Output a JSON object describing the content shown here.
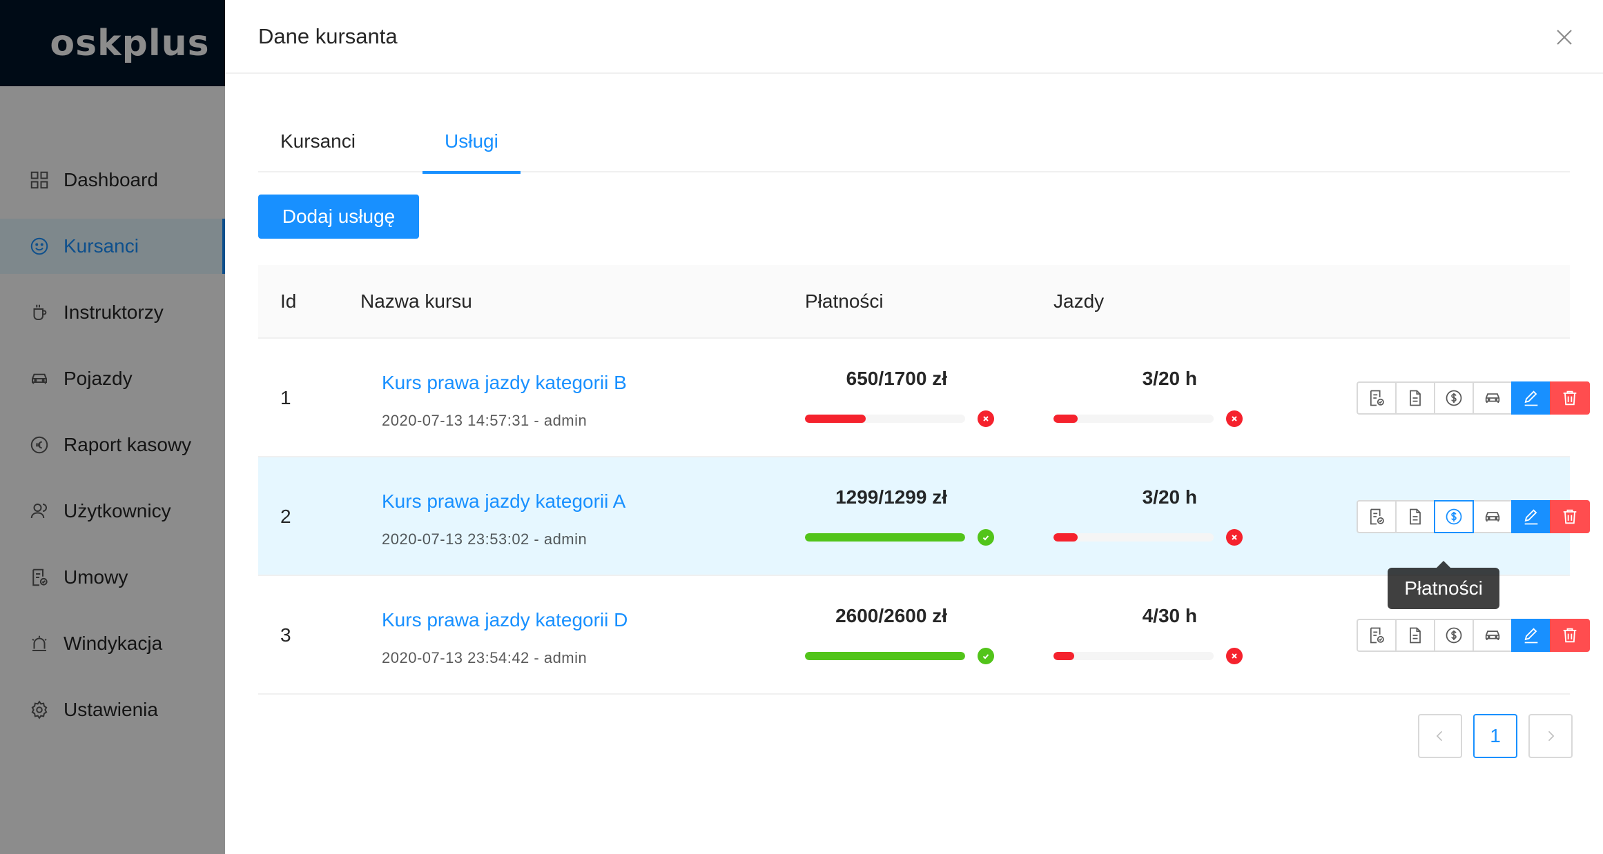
{
  "app": {
    "logo": "oskplus"
  },
  "sidebar": {
    "items": [
      {
        "label": "Dashboard",
        "icon": "dashboard-icon"
      },
      {
        "label": "Kursanci",
        "icon": "smile-icon",
        "active": true
      },
      {
        "label": "Instruktorzy",
        "icon": "coffee-icon"
      },
      {
        "label": "Pojazdy",
        "icon": "car-icon"
      },
      {
        "label": "Raport kasowy",
        "icon": "euro-icon"
      },
      {
        "label": "Użytkownicy",
        "icon": "users-icon"
      },
      {
        "label": "Umowy",
        "icon": "contract-icon"
      },
      {
        "label": "Windykacja",
        "icon": "alarm-icon"
      },
      {
        "label": "Ustawienia",
        "icon": "gear-icon"
      }
    ]
  },
  "drawer": {
    "title": "Dane kursanta",
    "tabs": [
      {
        "label": "Kursanci",
        "active": false
      },
      {
        "label": "Usługi",
        "active": true
      }
    ],
    "add_button": "Dodaj usługę",
    "table": {
      "columns": [
        "Id",
        "Nazwa kursu",
        "Płatności",
        "Jazdy"
      ],
      "rows": [
        {
          "id": "1",
          "course": "Kurs prawa jazdy kategorii B",
          "meta": "2020-07-13 14:57:31 - admin",
          "payment": "650/1700 zł",
          "payment_progress": 0.38,
          "payment_status": "error",
          "rides": "3/20 h",
          "rides_progress": 0.15,
          "rides_status": "error"
        },
        {
          "id": "2",
          "course": "Kurs prawa jazdy kategorii A",
          "meta": "2020-07-13 23:53:02 - admin",
          "payment": "1299/1299 zł",
          "payment_progress": 1.0,
          "payment_status": "success",
          "rides": "3/20 h",
          "rides_progress": 0.15,
          "rides_status": "error"
        },
        {
          "id": "3",
          "course": "Kurs prawa jazdy kategorii D",
          "meta": "2020-07-13 23:54:42 - admin",
          "payment": "2600/2600 zł",
          "payment_progress": 1.0,
          "payment_status": "success",
          "rides": "4/30 h",
          "rides_progress": 0.13,
          "rides_status": "error"
        }
      ]
    },
    "tooltip": "Płatności",
    "pagination": {
      "current": "1"
    }
  },
  "colors": {
    "primary": "#1890ff",
    "danger": "#ff4d4f",
    "progress_red": "#f5222d",
    "progress_green": "#52c41a",
    "sidebar_header": "#001529"
  }
}
